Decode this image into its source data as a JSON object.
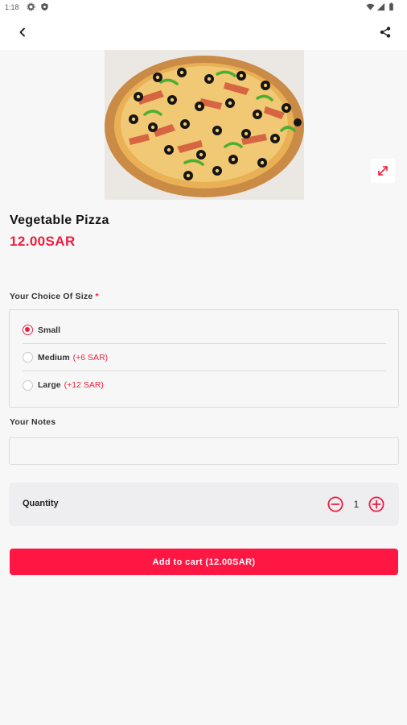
{
  "status_bar": {
    "time": "1:18"
  },
  "app_bar": {
    "back_icon": "chevron-left-icon",
    "share_icon": "share-icon"
  },
  "product": {
    "name": "Vegetable Pizza",
    "price": "12.00SAR",
    "image_icon": "pizza-image",
    "expand_icon": "expand-icon"
  },
  "size_section": {
    "label": "Your Choice Of Size",
    "required_mark": "*",
    "options": [
      {
        "label": "Small",
        "extra": "",
        "selected": true
      },
      {
        "label": "Medium",
        "extra": "(+6 SAR)",
        "selected": false
      },
      {
        "label": "Large",
        "extra": "(+12 SAR)",
        "selected": false
      }
    ]
  },
  "notes": {
    "label": "Your Notes",
    "value": "",
    "placeholder": ""
  },
  "quantity": {
    "label": "Quantity",
    "value": "1"
  },
  "cart_button": {
    "label": "Add to cart (12.00SAR)"
  },
  "colors": {
    "accent": "#ff1744",
    "price": "#ee1d3f",
    "background": "#f7f7f7"
  }
}
